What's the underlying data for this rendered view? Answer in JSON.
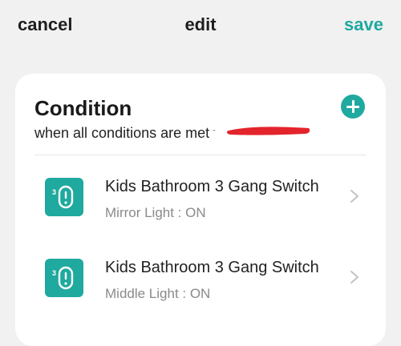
{
  "header": {
    "cancel_label": "cancel",
    "title": "edit",
    "save_label": "save"
  },
  "condition_section": {
    "heading": "Condition",
    "mode_label": "when all conditions are met",
    "add_icon": "plus-circle-icon",
    "items": [
      {
        "device_name": "Kids Bathroom 3 Gang Switch",
        "state": "Mirror Light : ON",
        "icon": "switch-device-icon"
      },
      {
        "device_name": "Kids Bathroom 3 Gang Switch",
        "state": "Middle Light : ON",
        "icon": "switch-device-icon"
      }
    ]
  },
  "colors": {
    "accent": "#1fa99f",
    "background": "#f1f1f1",
    "card": "#ffffff",
    "redaction": "#e3242b"
  }
}
